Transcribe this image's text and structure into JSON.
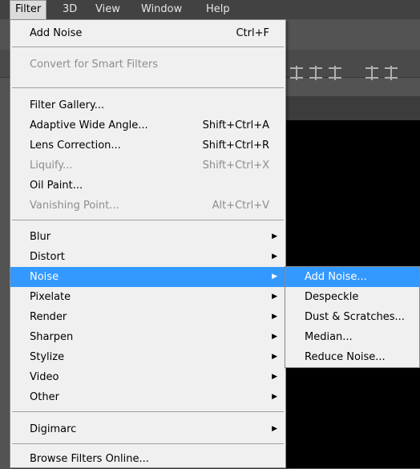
{
  "menubar": {
    "items": [
      "Filter",
      "3D",
      "View",
      "Window",
      "Help"
    ],
    "active": "Filter"
  },
  "filter_menu": {
    "last_filter": {
      "label": "Add Noise",
      "shortcut": "Ctrl+F"
    },
    "convert": {
      "label": "Convert for Smart Filters"
    },
    "group1": [
      {
        "label": "Filter Gallery...",
        "shortcut": "",
        "disabled": false
      },
      {
        "label": "Adaptive Wide Angle...",
        "shortcut": "Shift+Ctrl+A",
        "disabled": false
      },
      {
        "label": "Lens Correction...",
        "shortcut": "Shift+Ctrl+R",
        "disabled": false
      },
      {
        "label": "Liquify...",
        "shortcut": "Shift+Ctrl+X",
        "disabled": true
      },
      {
        "label": "Oil Paint...",
        "shortcut": "",
        "disabled": false
      },
      {
        "label": "Vanishing Point...",
        "shortcut": "Alt+Ctrl+V",
        "disabled": true
      }
    ],
    "submenus": [
      {
        "label": "Blur"
      },
      {
        "label": "Distort"
      },
      {
        "label": "Noise",
        "highlighted": true
      },
      {
        "label": "Pixelate"
      },
      {
        "label": "Render"
      },
      {
        "label": "Sharpen"
      },
      {
        "label": "Stylize"
      },
      {
        "label": "Video"
      },
      {
        "label": "Other"
      }
    ],
    "digimarc": {
      "label": "Digimarc"
    },
    "browse": {
      "label": "Browse Filters Online..."
    }
  },
  "noise_submenu": {
    "items": [
      {
        "label": "Add Noise...",
        "highlighted": true
      },
      {
        "label": "Despeckle"
      },
      {
        "label": "Dust & Scratches..."
      },
      {
        "label": "Median..."
      },
      {
        "label": "Reduce Noise..."
      }
    ]
  },
  "colors": {
    "highlight": "#3399ff",
    "menu_bg": "#f0f0f0",
    "menubar_bg": "#424242",
    "disabled_text": "#8d8d8d"
  }
}
